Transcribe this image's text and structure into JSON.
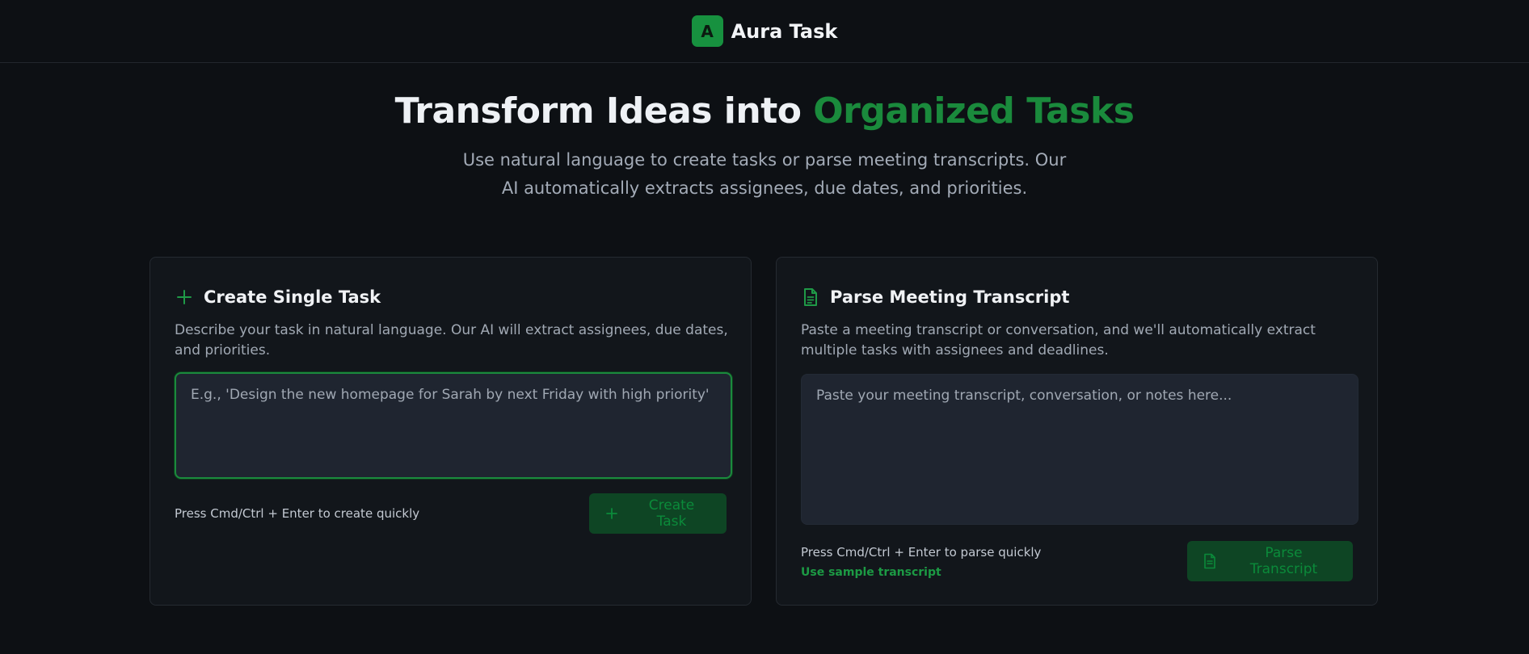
{
  "app": {
    "logo_letter": "A",
    "title": "Aura Task"
  },
  "hero": {
    "title_main": "Transform Ideas into ",
    "title_accent": "Organized Tasks",
    "subtitle": "Use natural language to create tasks or parse meeting transcripts. Our AI automatically extracts assignees, due dates, and priorities."
  },
  "single_task": {
    "icon": "plus-icon",
    "title": "Create Single Task",
    "description": "Describe your task in natural language. Our AI will extract assignees, due dates, and priorities.",
    "input_value": "",
    "placeholder": "E.g., 'Design the new homepage for Sarah by next Friday with high priority'",
    "hint": "Press Cmd/Ctrl + Enter to create quickly",
    "button_icon": "plus-icon",
    "button_label": "Create Task"
  },
  "transcript": {
    "icon": "document-icon",
    "title": "Parse Meeting Transcript",
    "description": "Paste a meeting transcript or conversation, and we'll automatically extract multiple tasks with assignees and deadlines.",
    "input_value": "",
    "placeholder": "Paste your meeting transcript, conversation, or notes here...",
    "hint": "Press Cmd/Ctrl + Enter to parse quickly",
    "sample_link": "Use sample transcript",
    "button_icon": "document-icon",
    "button_label": "Parse Transcript"
  },
  "colors": {
    "background": "#0d1014",
    "accent": "#1a8a3c",
    "card": "#12161b",
    "input": "#1f2530",
    "button_disabled_bg": "#0e4524"
  }
}
